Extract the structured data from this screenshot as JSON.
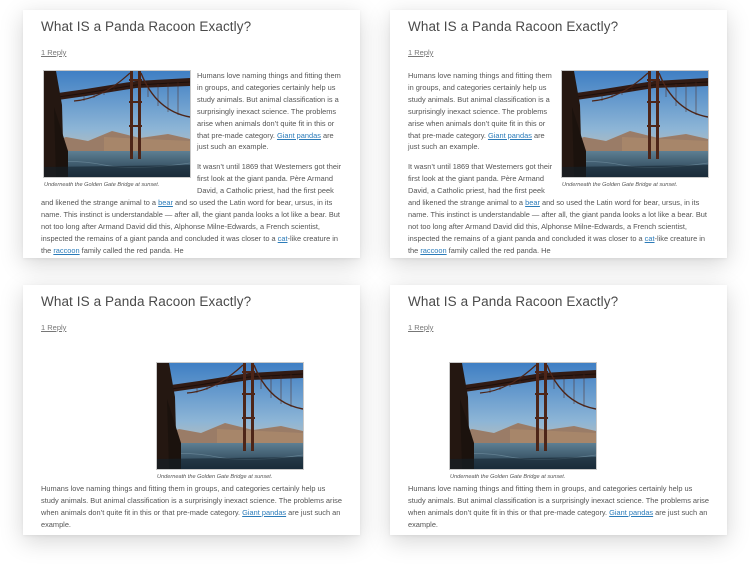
{
  "post": {
    "title": "What IS a Panda Racoon Exactly?",
    "reply": "1 Reply",
    "caption": "Underneath the Golden Gate Bridge at sunset.",
    "para1": {
      "before": "Humans love naming things and fitting them in groups, and categories certainly help us study animals. But animal classification is a surprisingly inexact science. The problems arise when animals don’t quite fit in this or that pre-made category.  ",
      "link": "Giant pandas",
      "after": " are just such an example."
    },
    "para2": {
      "t1": "It wasn’t until 1869 that Westerners got their first look at the giant panda. Père Armand David, a Catholic priest, had the first peek and likened the strange animal to a ",
      "link_bear": "bear",
      "t2": " and so used the Latin word for bear, ursus, in its name. This instinct is understandable — after all, the giant panda looks a lot like a bear. But not too long after Armand David did this, Alphonse Milne-Edwards, a French scientist, inspected the remains of a giant panda and concluded it was closer to a ",
      "link_cat": "cat",
      "t3": "-like creature in the ",
      "link_raccoon": "raccoon",
      "t4": " family called the red panda. He"
    }
  },
  "colors": {
    "link": "#2b7bb9",
    "text": "#555555",
    "title": "#4a4a4a"
  },
  "image": {
    "subject": "Golden Gate Bridge at sunset",
    "icon": "photo-image"
  }
}
